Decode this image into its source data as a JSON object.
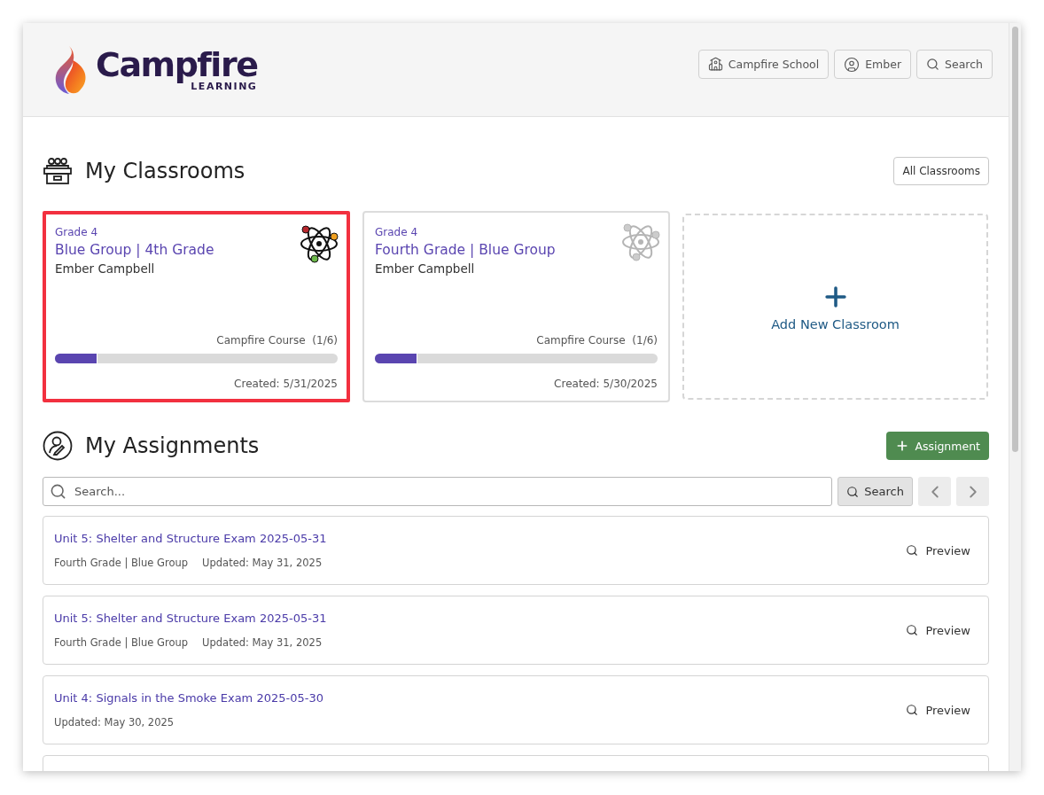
{
  "header": {
    "logo": {
      "name": "Campfire",
      "tagline": "LEARNING"
    },
    "buttons": [
      {
        "kind": "school",
        "label": "Campfire School"
      },
      {
        "kind": "user",
        "label": "Ember"
      },
      {
        "kind": "search",
        "label": "Search"
      }
    ]
  },
  "classrooms": {
    "title": "My Classrooms",
    "all_button": "All Classrooms",
    "cards": [
      {
        "grade": "Grade 4",
        "name": "Blue Group | 4th Grade",
        "teacher": "Ember Campbell",
        "course": "Campfire Course",
        "progress": "(1/6)",
        "level": 0.15,
        "created": "Created: 5/31/2025",
        "selected": true
      },
      {
        "grade": "Grade 4",
        "name": "Fourth Grade | Blue Group",
        "teacher": "Ember Campbell",
        "course": "Campfire Course",
        "progress": "(1/6)",
        "level": 0.15,
        "created": "Created: 5/30/2025",
        "selected": false
      }
    ],
    "add_label": "Add New Classroom"
  },
  "assignments": {
    "title": "My Assignments",
    "add_button": "Assignment",
    "search": {
      "placeholder": "Search...",
      "button": "Search"
    },
    "items": [
      {
        "title": "Unit 5: Shelter and Structure Exam 2025-05-31",
        "classroom": "Fourth Grade | Blue Group",
        "updated": "Updated: May 31, 2025",
        "action": "Preview"
      },
      {
        "title": "Unit 5: Shelter and Structure Exam 2025-05-31",
        "classroom": "Fourth Grade | Blue Group",
        "updated": "Updated: May 31, 2025",
        "action": "Preview"
      },
      {
        "title": "Unit 4: Signals in the Smoke Exam 2025-05-30",
        "updated": "Updated: May 30, 2025",
        "action": "Preview"
      }
    ]
  }
}
